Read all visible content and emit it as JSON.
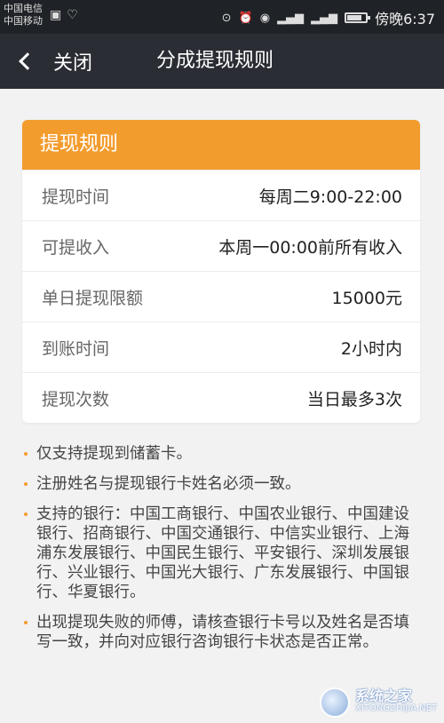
{
  "status_bar": {
    "carrier_line1": "中国电信",
    "carrier_line2": "中国移动",
    "time": "傍晚6:37",
    "battery_level": 0.8
  },
  "nav": {
    "close_label": "关闭",
    "title": "分成提现规则"
  },
  "rules_card": {
    "header": "提现规则",
    "rows": [
      {
        "label": "提现时间",
        "value": "每周二9:00-22:00"
      },
      {
        "label": "可提收入",
        "value": "本周一00:00前所有收入"
      },
      {
        "label": "单日提现限额",
        "value": "15000元"
      },
      {
        "label": "到账时间",
        "value": "2小时内"
      },
      {
        "label": "提现次数",
        "value": "当日最多3次"
      }
    ]
  },
  "notes": [
    "仅支持提现到储蓄卡。",
    "注册姓名与提现银行卡姓名必须一致。",
    "支持的银行：中国工商银行、中国农业银行、中国建设银行、招商银行、中国交通银行、中信实业银行、上海浦东发展银行、中国民生银行、平安银行、深圳发展银行、兴业银行、中国光大银行、广东发展银行、中国银行、华夏银行。",
    "出现提现失败的师傅，请核查银行卡号以及姓名是否填写一致，并向对应银行咨询银行卡状态是否正常。"
  ],
  "colors": {
    "accent": "#f39c2e",
    "nav_bg": "#2a2d33"
  },
  "watermark": {
    "main": "系统之家",
    "sub": "XITONGZHIJIA.NET"
  }
}
